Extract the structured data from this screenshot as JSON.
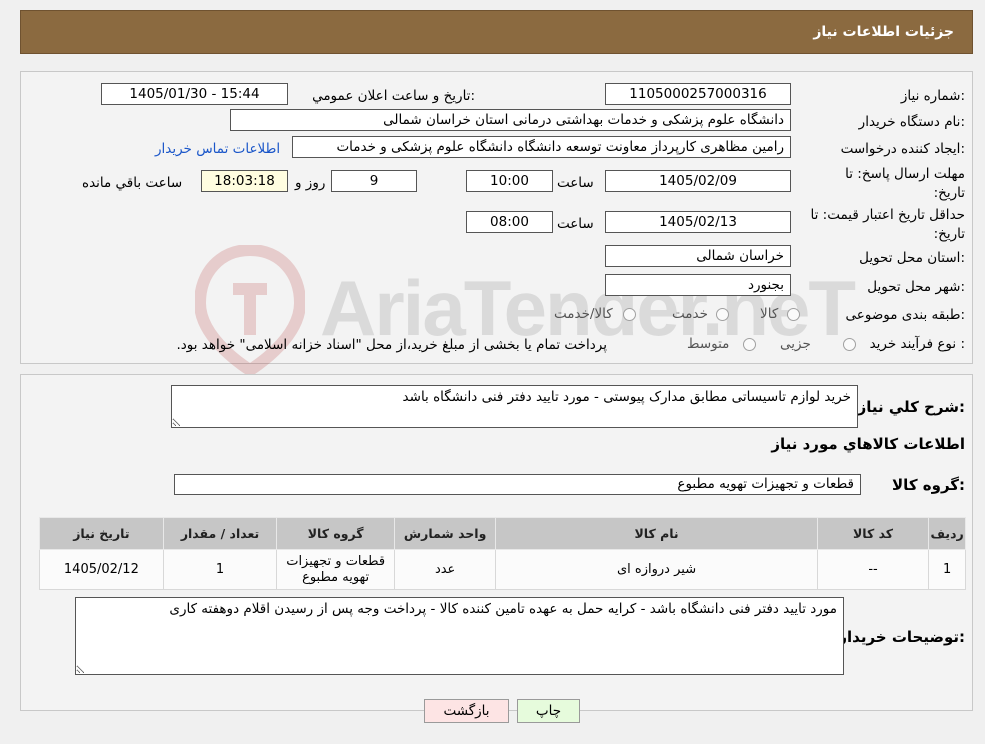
{
  "header": {
    "title": "جزئیات اطلاعات نیاز"
  },
  "fields": {
    "need_number_label": "شماره نیاز:",
    "need_number": "1105000257000316",
    "announce_label": "تاریخ و ساعت اعلان عمومي:",
    "announce_value": "1405/01/30 - 15:44",
    "buyer_org_label": "نام دستگاه خریدار:",
    "buyer_org": "دانشگاه علوم پزشکی و خدمات بهداشتی درمانی استان خراسان شمالی",
    "requester_label": "ایجاد کننده درخواست:",
    "requester": "رامین مظاهری کارپرداز معاونت توسعه دانشگاه دانشگاه علوم پزشکی و خدمات",
    "contact_link": "اطلاعات تماس خریدار",
    "deadline_label": "مهلت ارسال پاسخ: تا تاریخ:",
    "deadline_date": "1405/02/09",
    "time_label": "ساعت",
    "deadline_time": "10:00",
    "days": "9",
    "days_label": "روز و",
    "remaining_time": "18:03:18",
    "remaining_label": "ساعت باقي مانده",
    "validity_label": "حداقل تاریخ اعتبار قیمت: تا تاریخ:",
    "validity_date": "1405/02/13",
    "validity_time": "08:00",
    "province_label": "استان محل تحویل:",
    "province": "خراسان شمالی",
    "city_label": "شهر محل تحویل:",
    "city": "بجنورد",
    "category_label": "طبقه بندی موضوعی:",
    "category_options": [
      "کالا",
      "خدمت",
      "کالا/خدمت"
    ],
    "process_label": "نوع فرآیند خرید :",
    "process_options": [
      "جزیی",
      "متوسط"
    ],
    "process_note": "پرداخت تمام یا بخشی از مبلغ خرید،از محل \"اسناد خزانه اسلامی\" خواهد بود."
  },
  "summary": {
    "label": "شرح کلي نياز:",
    "text": "خرید لوازم تاسیساتی مطابق مدارک پیوستی - مورد تایید دفتر فنی دانشگاه باشد",
    "goods_info_title": "اطلاعات کالاهاي مورد نياز",
    "goods_group_label": "گروه کالا:",
    "goods_group": "قطعات و تجهیزات تهویه مطبوع"
  },
  "table": {
    "headers": [
      "رديف",
      "کد کالا",
      "نام کالا",
      "واحد شمارش",
      "گروه کالا",
      "تعداد / مقدار",
      "تاريخ نياز"
    ],
    "rows": [
      [
        "1",
        "--",
        "شیر دروازه ای",
        "عدد",
        "قطعات و تجهیزات تهویه مطبوع",
        "1",
        "1405/02/12"
      ]
    ]
  },
  "notes": {
    "label": "توضيحات خريدار:",
    "text": "مورد تایید دفتر فنی دانشگاه باشد - کرایه حمل به عهده تامین کننده کالا - پرداخت وجه پس از رسیدن اقلام دوهفته کاری"
  },
  "buttons": {
    "print": "چاپ",
    "back": "بازگشت"
  },
  "watermark": {
    "text": "AriaTender.neT"
  },
  "colors": {
    "header_bg": "#8b6a40",
    "print_bg": "#e6fbdc",
    "back_bg": "#fde4e4",
    "link": "#1a56c9"
  }
}
